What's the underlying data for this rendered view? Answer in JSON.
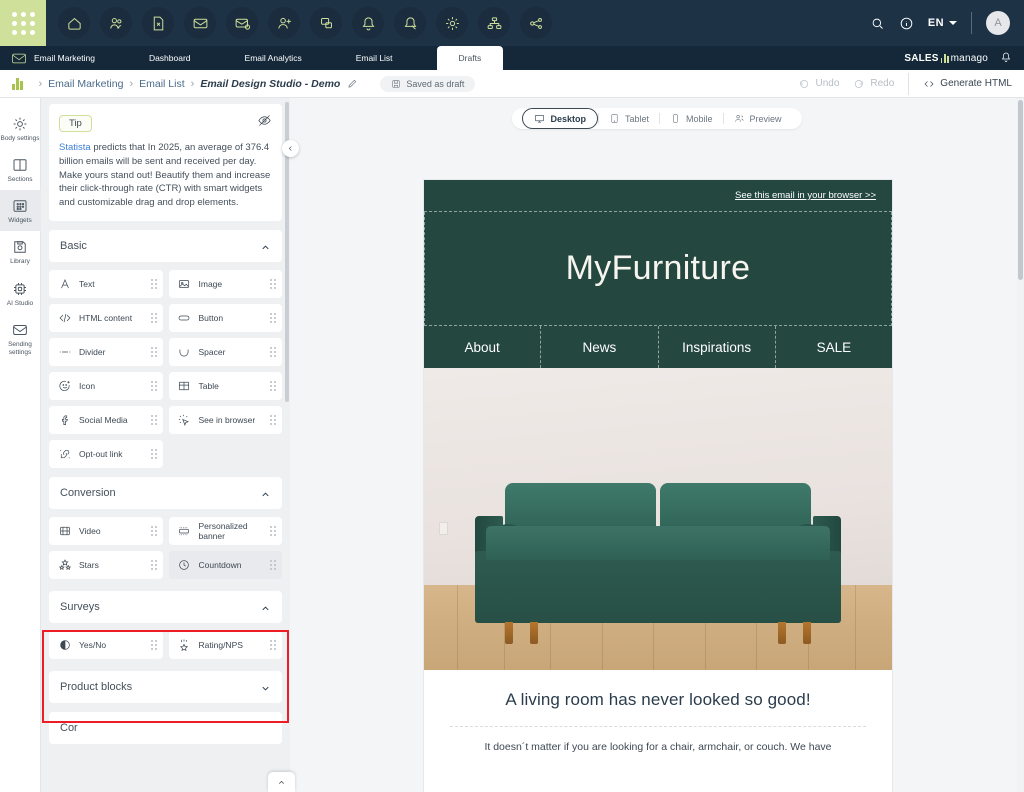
{
  "topbar": {
    "app_launcher": "app-launcher",
    "nav_icons": [
      {
        "name": "home-icon",
        "title": "Home"
      },
      {
        "name": "contacts-icon",
        "title": "Contacts"
      },
      {
        "name": "content-icon",
        "title": "Content"
      },
      {
        "name": "email-icon",
        "title": "Email"
      },
      {
        "name": "email-automation-icon",
        "title": "Email Automation"
      },
      {
        "name": "add-contact-icon",
        "title": "Add Contact"
      },
      {
        "name": "web-push-icon",
        "title": "Web Push"
      },
      {
        "name": "alerts-icon",
        "title": "Alerts"
      },
      {
        "name": "campaign-icon",
        "title": "Campaigns"
      },
      {
        "name": "settings-icon",
        "title": "Settings"
      },
      {
        "name": "workflow-icon",
        "title": "Workflow"
      },
      {
        "name": "automation-tree-icon",
        "title": "Automation"
      }
    ],
    "search": "search-icon",
    "info": "info-icon",
    "language": "EN",
    "avatar_initial": "A"
  },
  "tabbar": {
    "module": "Email Marketing",
    "tabs": [
      {
        "label": "Dashboard",
        "active": false
      },
      {
        "label": "Email Analytics",
        "active": false
      },
      {
        "label": "Email List",
        "active": false
      },
      {
        "label": "Drafts",
        "active": true
      }
    ],
    "brand": "SALES",
    "brand2": "manago",
    "bell": "notification-bell-icon"
  },
  "breadcrumb": {
    "items": [
      "Email Marketing",
      "Email List"
    ],
    "current": "Email Design Studio - Demo",
    "saved_status": "Saved as draft",
    "undo": "Undo",
    "redo": "Redo",
    "generate_html": "Generate HTML"
  },
  "rail": {
    "items": [
      {
        "label": "Body settings",
        "icon": "gear-icon",
        "active": false
      },
      {
        "label": "Sections",
        "icon": "columns-icon",
        "active": false
      },
      {
        "label": "Widgets",
        "icon": "widgets-grid-icon",
        "active": true
      },
      {
        "label": "Library",
        "icon": "save-disk-icon",
        "active": false
      },
      {
        "label": "AI Studio",
        "icon": "chip-icon",
        "active": false
      },
      {
        "label": "Sending settings",
        "icon": "envelope-icon",
        "active": false
      }
    ]
  },
  "tip": {
    "badge": "Tip",
    "link_text": "Statista",
    "body": " predicts that In 2025, an average of 376.4 billion emails will be sent and received per day. Make yours stand out! Beautify them and increase their click-through rate (CTR) with smart widgets and customizable drag and drop elements.",
    "hide_icon": "eye-off-icon"
  },
  "sections": [
    {
      "title": "Basic",
      "expanded": true,
      "widgets": [
        {
          "label": "Text",
          "icon": "text-icon",
          "selected": false
        },
        {
          "label": "Image",
          "icon": "image-icon",
          "selected": false
        },
        {
          "label": "HTML content",
          "icon": "code-icon",
          "selected": false
        },
        {
          "label": "Button",
          "icon": "button-icon",
          "selected": false
        },
        {
          "label": "Divider",
          "icon": "divider-icon",
          "selected": false
        },
        {
          "label": "Spacer",
          "icon": "spacer-icon",
          "selected": false
        },
        {
          "label": "Icon",
          "icon": "emoji-plus-icon",
          "selected": false
        },
        {
          "label": "Table",
          "icon": "table-icon",
          "selected": false
        },
        {
          "label": "Social Media",
          "icon": "facebook-icon",
          "selected": false
        },
        {
          "label": "See in browser",
          "icon": "cursor-click-icon",
          "selected": false
        },
        {
          "label": "Opt-out link",
          "icon": "broken-link-icon",
          "selected": false
        }
      ]
    },
    {
      "title": "Conversion",
      "expanded": true,
      "widgets": [
        {
          "label": "Video",
          "icon": "film-icon",
          "selected": false
        },
        {
          "label": "Personalized banner",
          "icon": "banner-icon",
          "selected": false
        },
        {
          "label": "Stars",
          "icon": "stars-icon",
          "selected": false
        },
        {
          "label": "Countdown",
          "icon": "clock-icon",
          "selected": true
        }
      ]
    },
    {
      "title": "Surveys",
      "expanded": true,
      "highlighted": true,
      "widgets": [
        {
          "label": "Yes/No",
          "icon": "half-circle-icon",
          "selected": false
        },
        {
          "label": "Rating/NPS",
          "icon": "rating-star-icon",
          "selected": false
        }
      ]
    },
    {
      "title": "Product blocks",
      "expanded": false,
      "widgets": []
    }
  ],
  "canvas": {
    "modes": [
      {
        "label": "Desktop",
        "icon": "monitor-icon",
        "active": true
      },
      {
        "label": "Tablet",
        "icon": "tablet-icon",
        "active": false
      },
      {
        "label": "Mobile",
        "icon": "mobile-icon",
        "active": false
      },
      {
        "label": "Preview",
        "icon": "persons-icon",
        "active": false
      }
    ]
  },
  "email": {
    "browser_link": "See this email in your browser >>",
    "logo": "MyFurniture",
    "nav": [
      "About",
      "News",
      "Inspirations",
      "SALE"
    ],
    "headline": "A living room has never looked so good!",
    "body": "It doesn´t matter if you are looking for a chair, armchair, or couch. We have"
  },
  "colors": {
    "topbar": "#1e3246",
    "tabbar": "#14283a",
    "accent_green": "#cfe09a",
    "email_dark_green": "#24473f",
    "highlight_red": "#ee1c25",
    "link_blue": "#3d7fd6"
  }
}
